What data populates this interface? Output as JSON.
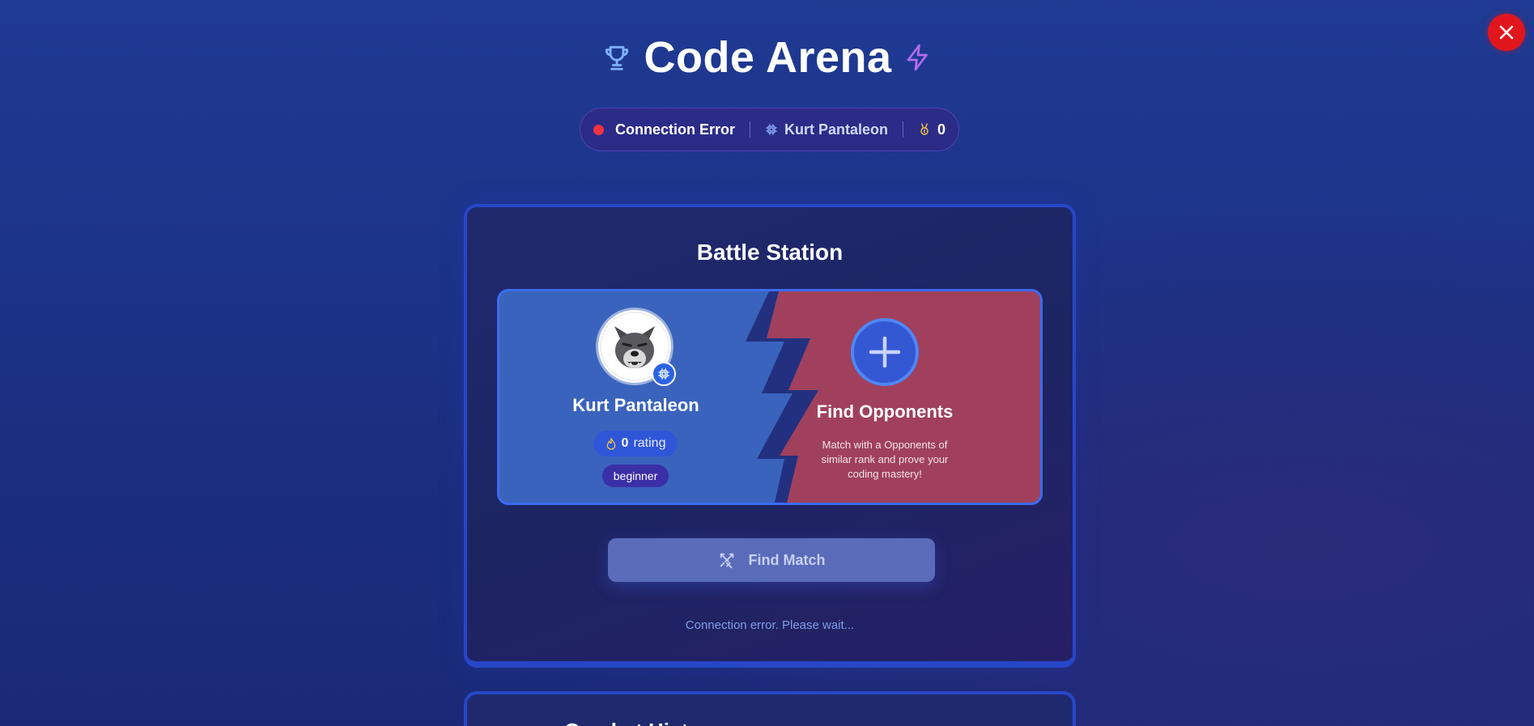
{
  "app": {
    "title": "Code Arena",
    "close_icon": "close-icon"
  },
  "status_bar": {
    "connection": "Connection Error",
    "username": "Kurt Pantaleon",
    "score": "0"
  },
  "battle_station": {
    "title": "Battle Station",
    "player": {
      "name": "Kurt Pantaleon",
      "rating_value": "0",
      "rating_label": "rating",
      "rank": "beginner"
    },
    "opponent": {
      "title": "Find Opponents",
      "description": "Match with a Opponents of similar rank and prove your coding mastery!"
    },
    "find_match_label": "Find Match",
    "status_message": "Connection error. Please wait..."
  },
  "history": {
    "title": "Combat History"
  },
  "colors": {
    "accent_blue": "#3b6cf0",
    "player_panel": "#3a63bd",
    "opponent_panel": "#a0405c",
    "error_red": "#e0161c"
  }
}
